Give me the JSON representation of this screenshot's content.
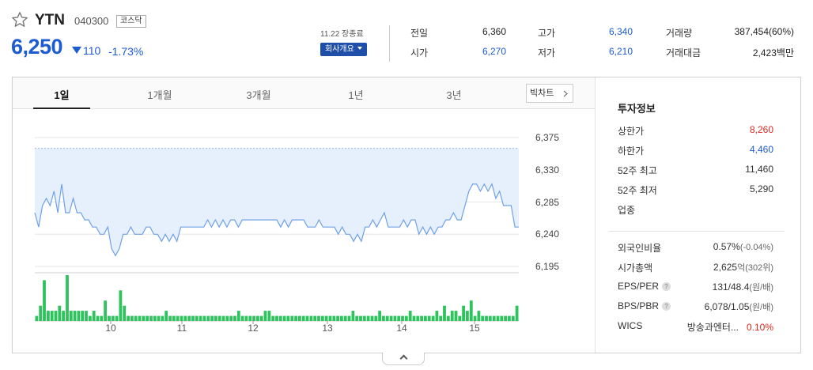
{
  "stock": {
    "name": "YTN",
    "code": "040300",
    "market": "코스닥",
    "price": "6,250",
    "change": "110",
    "change_pct": "-1.73%",
    "date_status": "11.22 장종료",
    "company_button": "회사개요"
  },
  "quotes": [
    {
      "label": "전일",
      "value": "6,360",
      "color": "#222222"
    },
    {
      "label": "고가",
      "value": "6,340",
      "color": "#1d5bd2"
    },
    {
      "label": "거래량",
      "value": "387,454(60%)",
      "color": "#222222"
    },
    {
      "label": "시가",
      "value": "6,270",
      "color": "#1d5bd2"
    },
    {
      "label": "저가",
      "value": "6,210",
      "color": "#1d5bd2"
    },
    {
      "label": "거래대금",
      "value": "2,423백만",
      "color": "#222222"
    }
  ],
  "tabs": [
    "1일",
    "1개월",
    "3개월",
    "1년",
    "3년"
  ],
  "big_chart_label": "빅차트",
  "chart_data": {
    "type": "line",
    "yticks": [
      "6,375",
      "6,330",
      "6,285",
      "6,240",
      "6,195"
    ],
    "ylim": [
      6195,
      6375
    ],
    "xticks": [
      "10",
      "11",
      "12",
      "13",
      "14",
      "15"
    ],
    "prev_close": 6360,
    "series": [
      {
        "name": "",
        "values": [
          6270,
          6250,
          6280,
          6290,
          6280,
          6300,
          6270,
          6310,
          6270,
          6270,
          6290,
          6270,
          6270,
          6260,
          6260,
          6250,
          6250,
          6240,
          6240,
          6250,
          6220,
          6210,
          6220,
          6240,
          6240,
          6250,
          6240,
          6240,
          6240,
          6250,
          6250,
          6240,
          6240,
          6230,
          6240,
          6230,
          6240,
          6230,
          6250,
          6250,
          6250,
          6250,
          6250,
          6250,
          6250,
          6260,
          6250,
          6260,
          6250,
          6260,
          6250,
          6260,
          6260,
          6250,
          6260,
          6260,
          6260,
          6260,
          6260,
          6260,
          6260,
          6260,
          6260,
          6260,
          6250,
          6260,
          6250,
          6260,
          6260,
          6260,
          6260,
          6250,
          6250,
          6250,
          6260,
          6250,
          6250,
          6250,
          6250,
          6240,
          6250,
          6240,
          6240,
          6230,
          6240,
          6230,
          6250,
          6250,
          6260,
          6250,
          6260,
          6270,
          6250,
          6250,
          6250,
          6250,
          6260,
          6250,
          6260,
          6260,
          6240,
          6250,
          6240,
          6250,
          6240,
          6250,
          6250,
          6260,
          6260,
          6270,
          6260,
          6260,
          6280,
          6300,
          6310,
          6310,
          6300,
          6310,
          6300,
          6310,
          6290,
          6300,
          6280,
          6280,
          6280,
          6250,
          6250
        ],
        "color": "#6ea0e8"
      },
      {
        "name": "",
        "values": [
          1,
          3,
          8,
          2,
          2,
          2,
          3,
          2,
          9,
          2,
          2,
          2,
          2,
          2,
          1,
          2,
          1,
          1,
          4,
          1,
          1,
          1,
          6,
          3,
          1,
          1,
          1,
          1,
          1,
          1,
          1,
          1,
          1,
          1,
          2,
          1,
          1,
          1,
          1,
          1,
          1,
          1,
          1,
          1,
          1,
          1,
          1,
          1,
          1,
          1,
          1,
          1,
          1,
          2,
          1,
          1,
          1,
          1,
          1,
          1,
          2,
          2,
          1,
          1,
          1,
          1,
          1,
          1,
          1,
          1,
          1,
          1,
          1,
          1,
          1,
          1,
          1,
          1,
          1,
          1,
          1,
          1,
          1,
          2,
          1,
          1,
          1,
          1,
          1,
          1,
          2,
          1,
          1,
          1,
          1,
          1,
          1,
          1,
          2,
          1,
          1,
          1,
          1,
          1,
          1,
          2,
          1,
          3,
          1,
          2,
          2,
          1,
          3,
          2,
          4,
          1,
          2,
          1,
          1,
          1,
          1,
          1,
          1,
          1,
          1,
          1,
          3
        ],
        "color": "#2ec35c"
      }
    ]
  },
  "info": {
    "title": "투자정보",
    "rows1": [
      {
        "label": "상한가",
        "value": "8,260",
        "color": "#e0251c"
      },
      {
        "label": "하한가",
        "value": "4,460",
        "color": "#1d5bd2"
      },
      {
        "label": "52주 최고",
        "value": "11,460",
        "color": "#333333"
      },
      {
        "label": "52주 최저",
        "value": "5,290",
        "color": "#333333"
      },
      {
        "label": "업종",
        "value": "",
        "color": "#333333"
      }
    ],
    "rows2": [
      {
        "label": "외국인비율",
        "value": "0.57%",
        "unit": "(-0.04%)",
        "help": false
      },
      {
        "label": "시가총액",
        "value": "2,625",
        "unit": "억(302위)",
        "help": false
      },
      {
        "label": "EPS/PER",
        "value": "131/48.4",
        "unit": "(원/배)",
        "help": true
      },
      {
        "label": "BPS/PBR",
        "value": "6,078/1.05",
        "unit": "(원/배)",
        "help": true
      },
      {
        "label": "WICS",
        "value": "방송과엔터...",
        "unit": "0.10%",
        "help": false
      }
    ]
  }
}
